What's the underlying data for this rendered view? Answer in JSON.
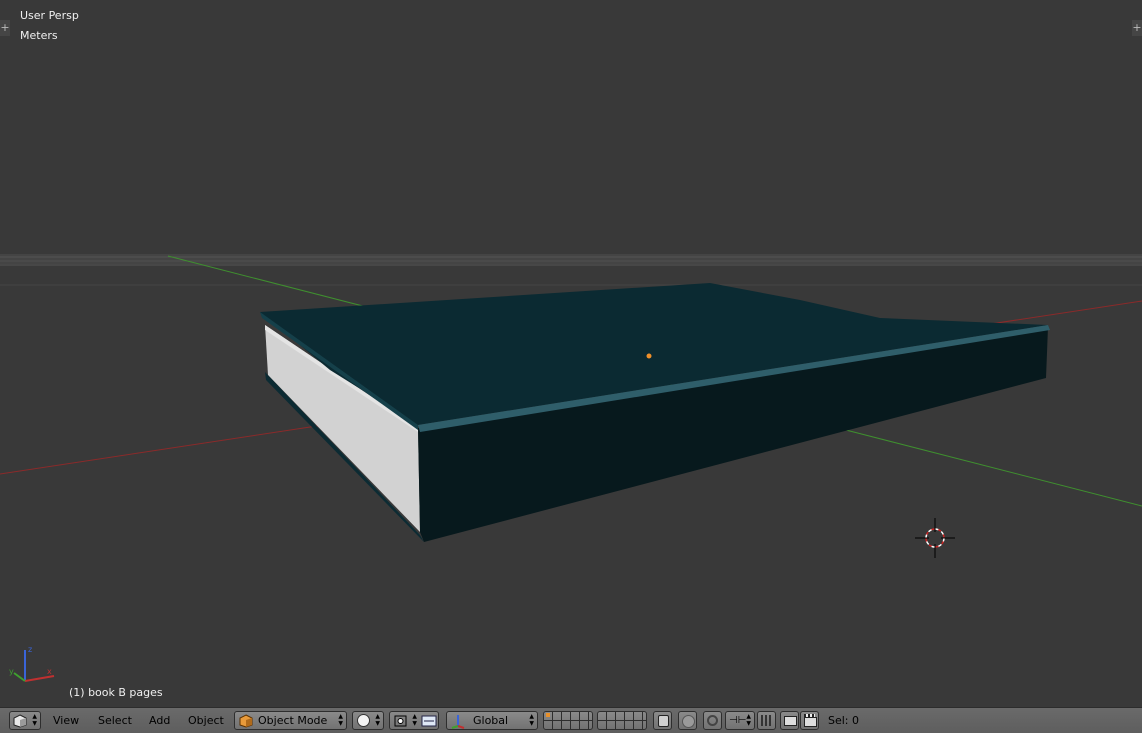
{
  "viewport": {
    "view_name": "User Persp",
    "units": "Meters",
    "object_info": "(1) book B pages",
    "axis_labels": {
      "z": "z",
      "x": "x",
      "y": "y"
    }
  },
  "header": {
    "menus": [
      "View",
      "Select",
      "Add",
      "Object"
    ],
    "mode": "Object Mode",
    "orientation": "Global",
    "selection": "Sel: 0"
  },
  "colors": {
    "background": "#393939",
    "book_cover": "#0b2a32",
    "book_pages": "#d8d8d8",
    "x_axis": "#8b2a2a",
    "y_axis": "#3f8f2f",
    "z_axis": "#3a64d8",
    "origin_dot": "#f0902a",
    "header": "#626262"
  }
}
